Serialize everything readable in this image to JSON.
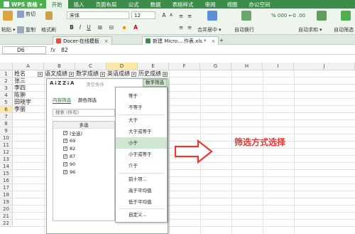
{
  "menubar": {
    "app_name": "WPS 表格",
    "tabs": [
      "开始",
      "插入",
      "页面布局",
      "公式",
      "数据",
      "表格样式",
      "审阅",
      "视图",
      "办公空间"
    ]
  },
  "ribbon": {
    "paste": "粘贴",
    "cut": "剪切",
    "copy": "复制",
    "format_painter": "格式刷",
    "font_name": "宋体",
    "font_size": "12",
    "merge_center": "合并居中",
    "wrap_text": "自动换行",
    "auto_sum": "自动求和",
    "auto_filter": "自动筛选"
  },
  "doc_tabs": [
    {
      "label": "Docer-在线模板",
      "active": false
    },
    {
      "label": "新建 Micro....作表.xls *",
      "active": true
    }
  ],
  "formula_bar": {
    "cell_ref": "D6",
    "fx": "fx",
    "value": "82"
  },
  "columns": [
    "A",
    "B",
    "C",
    "D",
    "E",
    "F",
    "G",
    "H",
    "I",
    "J"
  ],
  "rows": [
    "1",
    "2",
    "3",
    "4",
    "5",
    "6",
    "7",
    "8",
    "9",
    "10",
    "11",
    "12",
    "13",
    "14",
    "15",
    "16",
    "17",
    "18",
    "19",
    "20",
    "21",
    "22"
  ],
  "cells": {
    "A1": "姓名",
    "B1": "语文成绩",
    "C1": "数学成绩",
    "D1": "英语成绩",
    "E1": "历史成绩",
    "A2": "张三",
    "A3": "李四",
    "A4": "陈翀",
    "A5": "田晓宇",
    "A6": "李丽"
  },
  "filter_panel": {
    "sort_asc": "A↓Z",
    "sort_desc": "Z↓A",
    "clear_condition": "清空条件",
    "number_filter": "数字筛选",
    "tab_content": "内容筛选",
    "tab_color": "颜色筛选",
    "search_placeholder": "搜索 (所有)",
    "list_header": "多选",
    "items": [
      "(全选)",
      "69",
      "82",
      "87",
      "90",
      "96"
    ]
  },
  "number_filter_menu": {
    "items": [
      "等于",
      "不等于",
      "大于",
      "大于或等于",
      "小于",
      "小于或等于",
      "介于",
      "前十项...",
      "高于平均值",
      "低于平均值",
      "自定义..."
    ],
    "highlighted": "小于"
  },
  "annotation": "筛选方式选择",
  "colors": {
    "wps_green": "#3c8d4a",
    "ribbon_bg": "#eef5ef",
    "highlight": "#cfe6cf",
    "annotation_red": "#e53935"
  }
}
